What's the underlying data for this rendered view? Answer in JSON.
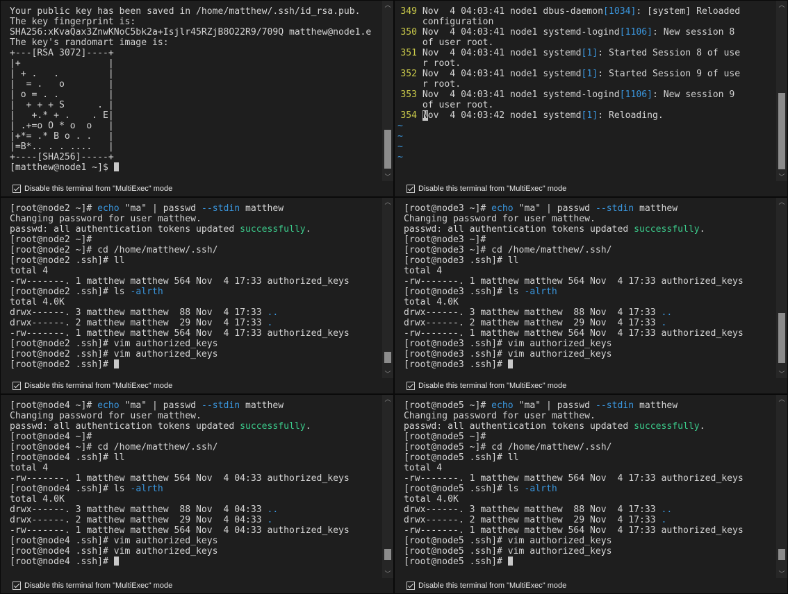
{
  "footer_label": "Disable this terminal from \"MultiExec\" mode",
  "panes": [
    {
      "id": "pane-node1",
      "lines": [
        "Your public key has been saved in /home/matthew/.ssh/id_rsa.pub.",
        "The key fingerprint is:",
        "SHA256:xKvaQax3ZnwKNoC5bk2a+Isjlr45RZjB8O22R9/709Q matthew@node1.e",
        "The key's randomart image is:",
        "+---[RSA 3072]----+",
        "|+                |",
        "| + .   .         |",
        "|  = .   o        |",
        "| o = . .         |",
        "|  + + + S      . |",
        "|   +.* + .    . E|",
        "| .+=o O * o  o   |",
        "|+*= .* B o . .   |",
        "|=B*.. . . ....   |",
        "+----[SHA256]-----+",
        "[matthew@node1 ~]$ "
      ]
    },
    {
      "id": "pane-vim-log",
      "rows": [
        {
          "n": "349",
          "a": "Nov  4 04:03:41 node1 dbus-daemon",
          "b": "[1034]",
          "c": ": [system] Reloaded"
        },
        {
          "n": "",
          "a": "configuration",
          "b": "",
          "c": ""
        },
        {
          "n": "350",
          "a": "Nov  4 04:03:41 node1 systemd-logind",
          "b": "[1106]",
          "c": ": New session 8"
        },
        {
          "n": "",
          "a": "of user root.",
          "b": "",
          "c": ""
        },
        {
          "n": "351",
          "a": "Nov  4 04:03:41 node1 systemd",
          "b": "[1]",
          "c": ": Started Session 8 of use"
        },
        {
          "n": "",
          "a": "r root.",
          "b": "",
          "c": ""
        },
        {
          "n": "352",
          "a": "Nov  4 04:03:41 node1 systemd",
          "b": "[1]",
          "c": ": Started Session 9 of use"
        },
        {
          "n": "",
          "a": "r root.",
          "b": "",
          "c": ""
        },
        {
          "n": "353",
          "a": "Nov  4 04:03:41 node1 systemd-logind",
          "b": "[1106]",
          "c": ": New session 9"
        },
        {
          "n": "",
          "a": "of user root.",
          "b": "",
          "c": ""
        },
        {
          "n": "354",
          "a": "Nov  4 04:03:42 node1 systemd",
          "b": "[1]",
          "c": ": Reloading."
        }
      ],
      "tildes": [
        "~",
        "~",
        "~",
        "~"
      ]
    }
  ],
  "node_panes": [
    {
      "host": "node2",
      "date_time": "Nov  4 17:33",
      "lines": [
        {
          "pre": "[root@node2 ~]# ",
          "hl": "echo",
          "mid": " \"ma\" | passwd ",
          "hl2": "--stdin",
          "post": " matthew"
        },
        {
          "pre": "Changing password for user matthew."
        },
        {
          "pre": "passwd: all authentication tokens updated ",
          "ok": "successfully",
          "post": "."
        },
        {
          "pre": "[root@node2 ~]#"
        },
        {
          "pre": "[root@node2 ~]# cd /home/matthew/.ssh/"
        },
        {
          "pre": "[root@node2 .ssh]# ll"
        },
        {
          "pre": "total 4"
        },
        {
          "pre": "-rw-------. 1 matthew matthew 564 Nov  4 17:33 authorized_keys"
        },
        {
          "pre": "[root@node2 .ssh]# ls ",
          "hl": "-alrth"
        },
        {
          "pre": "total 4.0K"
        },
        {
          "pre": "drwx------. 3 matthew matthew  88 Nov  4 17:33 ",
          "hl": ".."
        },
        {
          "pre": "drwx------. 2 matthew matthew  29 Nov  4 17:33 ",
          "hl": "."
        },
        {
          "pre": "-rw-------. 1 matthew matthew 564 Nov  4 17:33 authorized_keys"
        },
        {
          "pre": "[root@node2 .ssh]# vim authorized_keys"
        },
        {
          "pre": "[root@node2 .ssh]# vim authorized_keys"
        },
        {
          "pre": "[root@node2 .ssh]# ",
          "cursor": true
        }
      ]
    },
    {
      "host": "node3",
      "lines": [
        {
          "pre": "[root@node3 ~]# ",
          "hl": "echo",
          "mid": " \"ma\" | passwd ",
          "hl2": "--stdin",
          "post": " matthew"
        },
        {
          "pre": "Changing password for user matthew."
        },
        {
          "pre": "passwd: all authentication tokens updated ",
          "ok": "successfully",
          "post": "."
        },
        {
          "pre": "[root@node3 ~]#"
        },
        {
          "pre": "[root@node3 ~]# cd /home/matthew/.ssh/"
        },
        {
          "pre": "[root@node3 .ssh]# ll"
        },
        {
          "pre": "total 4"
        },
        {
          "pre": "-rw-------. 1 matthew matthew 564 Nov  4 17:33 authorized_keys"
        },
        {
          "pre": "[root@node3 .ssh]# ls ",
          "hl": "-alrth"
        },
        {
          "pre": "total 4.0K"
        },
        {
          "pre": "drwx------. 3 matthew matthew  88 Nov  4 17:33 ",
          "hl": ".."
        },
        {
          "pre": "drwx------. 2 matthew matthew  29 Nov  4 17:33 ",
          "hl": "."
        },
        {
          "pre": "-rw-------. 1 matthew matthew 564 Nov  4 17:33 authorized_keys"
        },
        {
          "pre": "[root@node3 .ssh]# vim authorized_keys"
        },
        {
          "pre": "[root@node3 .ssh]# vim authorized_keys"
        },
        {
          "pre": "[root@node3 .ssh]# ",
          "cursor": true
        }
      ]
    },
    {
      "host": "node4",
      "lines": [
        {
          "pre": "[root@node4 ~]# ",
          "hl": "echo",
          "mid": " \"ma\" | passwd ",
          "hl2": "--stdin",
          "post": " matthew"
        },
        {
          "pre": "Changing password for user matthew."
        },
        {
          "pre": "passwd: all authentication tokens updated ",
          "ok": "successfully",
          "post": "."
        },
        {
          "pre": "[root@node4 ~]#"
        },
        {
          "pre": "[root@node4 ~]# cd /home/matthew/.ssh/"
        },
        {
          "pre": "[root@node4 .ssh]# ll"
        },
        {
          "pre": "total 4"
        },
        {
          "pre": "-rw-------. 1 matthew matthew 564 Nov  4 04:33 authorized_keys"
        },
        {
          "pre": "[root@node4 .ssh]# ls ",
          "hl": "-alrth"
        },
        {
          "pre": "total 4.0K"
        },
        {
          "pre": "drwx------. 3 matthew matthew  88 Nov  4 04:33 ",
          "hl": ".."
        },
        {
          "pre": "drwx------. 2 matthew matthew  29 Nov  4 04:33 ",
          "hl": "."
        },
        {
          "pre": "-rw-------. 1 matthew matthew 564 Nov  4 04:33 authorized_keys"
        },
        {
          "pre": "[root@node4 .ssh]# vim authorized_keys"
        },
        {
          "pre": "[root@node4 .ssh]# vim authorized_keys"
        },
        {
          "pre": "[root@node4 .ssh]# ",
          "cursor": true
        }
      ]
    },
    {
      "host": "node5",
      "lines": [
        {
          "pre": "[root@node5 ~]# ",
          "hl": "echo",
          "mid": " \"ma\" | passwd ",
          "hl2": "--stdin",
          "post": " matthew"
        },
        {
          "pre": "Changing password for user matthew."
        },
        {
          "pre": "passwd: all authentication tokens updated ",
          "ok": "successfully",
          "post": "."
        },
        {
          "pre": "[root@node5 ~]#"
        },
        {
          "pre": "[root@node5 ~]# cd /home/matthew/.ssh/"
        },
        {
          "pre": "[root@node5 .ssh]# ll"
        },
        {
          "pre": "total 4"
        },
        {
          "pre": "-rw-------. 1 matthew matthew 564 Nov  4 17:33 authorized_keys"
        },
        {
          "pre": "[root@node5 .ssh]# ls ",
          "hl": "-alrth"
        },
        {
          "pre": "total 4.0K"
        },
        {
          "pre": "drwx------. 3 matthew matthew  88 Nov  4 17:33 ",
          "hl": ".."
        },
        {
          "pre": "drwx------. 2 matthew matthew  29 Nov  4 17:33 ",
          "hl": "."
        },
        {
          "pre": "-rw-------. 1 matthew matthew 564 Nov  4 17:33 authorized_keys"
        },
        {
          "pre": "[root@node5 .ssh]# vim authorized_keys"
        },
        {
          "pre": "[root@node5 .ssh]# vim authorized_keys"
        },
        {
          "pre": "[root@node5 .ssh]# ",
          "cursor": true
        }
      ]
    }
  ],
  "icons": {
    "scroll_up": "scroll-up-arrow-icon",
    "scroll_down": "scroll-down-arrow-icon",
    "checkbox": "checkbox-checked-icon"
  },
  "colors": {
    "background": "#1e1e1e",
    "text": "#d4d4d4",
    "highlight_blue": "#3a96dd",
    "success_green": "#3bc98a",
    "line_number_yellow": "#c9c94a"
  }
}
